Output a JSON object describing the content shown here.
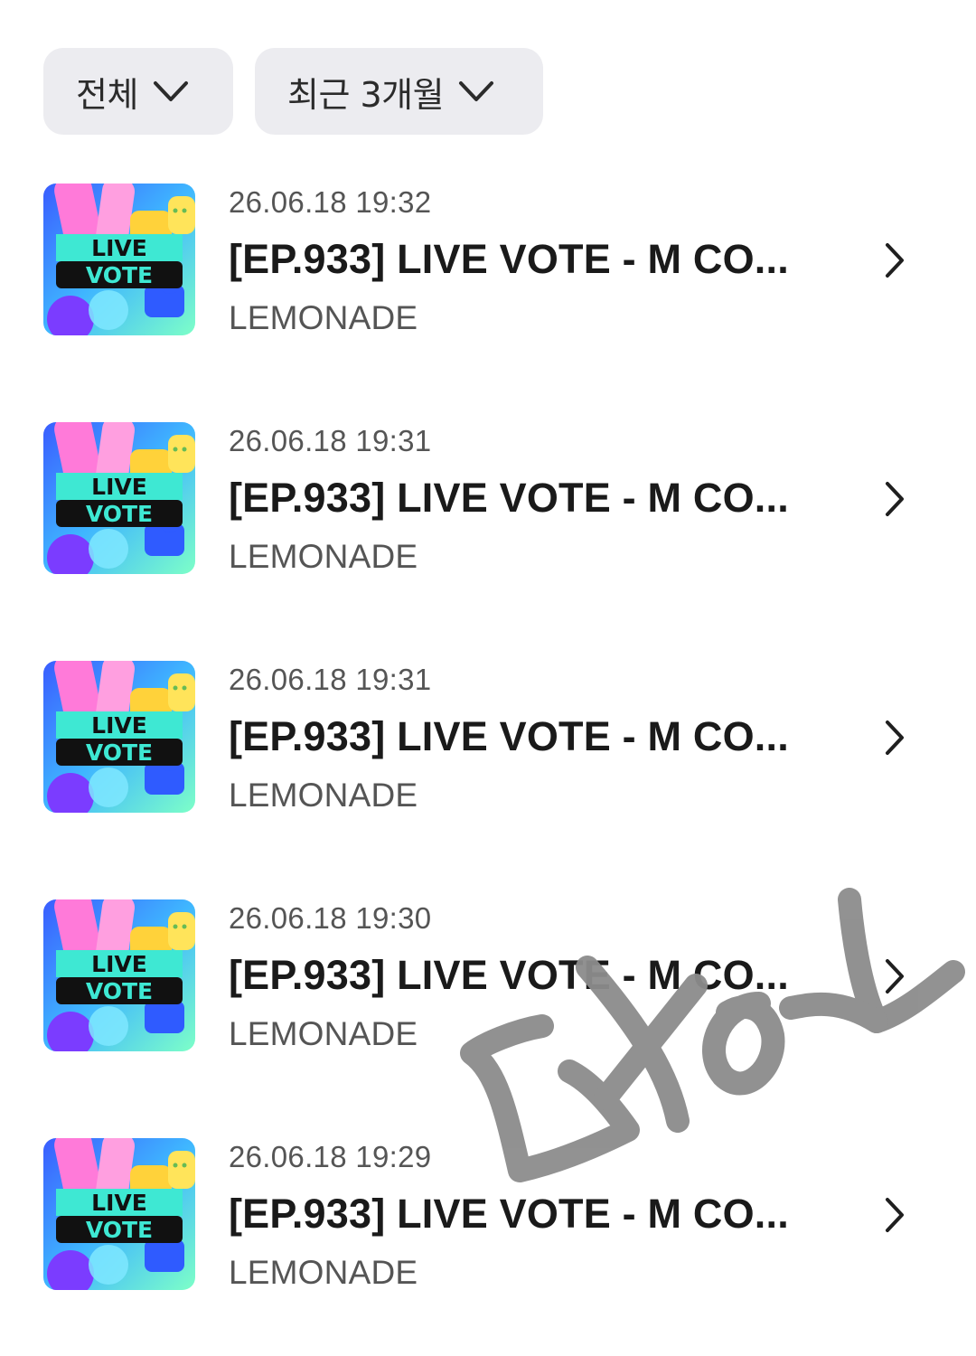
{
  "filters": {
    "category": {
      "label": "전체",
      "icon": "chevron-down-icon"
    },
    "period": {
      "label": "최근 3개월",
      "icon": "chevron-down-icon"
    }
  },
  "thumbnail": {
    "line1": "LIVE",
    "line2": "VOTE"
  },
  "items": [
    {
      "date": "26.06.18 19:32",
      "title": "[EP.933] LIVE VOTE - M CO...",
      "artist": "LEMONADE"
    },
    {
      "date": "26.06.18 19:31",
      "title": "[EP.933] LIVE VOTE - M CO...",
      "artist": "LEMONADE"
    },
    {
      "date": "26.06.18 19:31",
      "title": "[EP.933] LIVE VOTE - M CO...",
      "artist": "LEMONADE"
    },
    {
      "date": "26.06.18 19:30",
      "title": "[EP.933] LIVE VOTE - M CO...",
      "artist": "LEMONADE"
    },
    {
      "date": "26.06.18 19:29",
      "title": "[EP.933] LIVE VOTE - M CO...",
      "artist": "LEMONADE"
    }
  ],
  "row_icon": "chevron-right-icon",
  "colors": {
    "filter_bg": "#ececf0",
    "text_primary": "#1a1a1a",
    "text_secondary": "#555555",
    "scribble": "#8c8c8c"
  }
}
